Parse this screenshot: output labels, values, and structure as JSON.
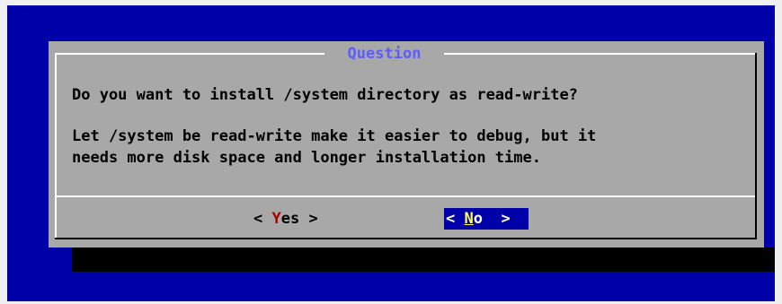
{
  "dialog": {
    "title": "Question",
    "question": "Do you want to install /system directory as read-write?",
    "detail_line1": "Let /system be read-write make it easier to debug, but it",
    "detail_line2": "needs more disk space and longer installation time."
  },
  "buttons": {
    "yes": {
      "open": "< ",
      "hotkey": "Y",
      "rest": "es",
      "close": " >",
      "selected": false
    },
    "no": {
      "open": "< ",
      "hotkey": "N",
      "rest": "o",
      "close": "  >",
      "selected": true
    }
  },
  "colors": {
    "background": "#0000a8",
    "dialog": "#a8a8a8",
    "title": "#5c5cff",
    "hotkey_unselected": "#a80000",
    "hotkey_selected": "#ffff54",
    "selected_button_bg": "#0000a8"
  }
}
